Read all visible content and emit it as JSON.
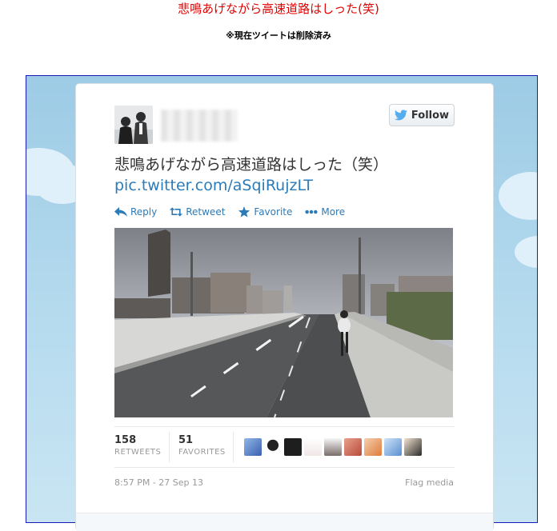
{
  "page": {
    "headline": "悲鳴あげながら高速道路はしった(笑)",
    "note": "※現在ツイートは削除済み"
  },
  "tweet": {
    "follow_label": "Follow",
    "text": "悲鳴あげながら高速道路はしった（笑）",
    "link": "pic.twitter.com/aSqiRujzLT",
    "actions": {
      "reply": "Reply",
      "retweet": "Retweet",
      "favorite": "Favorite",
      "more": "More"
    },
    "stats": {
      "retweets_count": "158",
      "retweets_label": "RETWEETS",
      "favorites_count": "51",
      "favorites_label": "FAVORITES"
    },
    "timestamp": "8:57 PM - 27 Sep 13",
    "flag_label": "Flag media"
  },
  "colors": {
    "headline": "#e00000",
    "link": "#2b7bb9",
    "frame_border": "#1a1ab8"
  }
}
